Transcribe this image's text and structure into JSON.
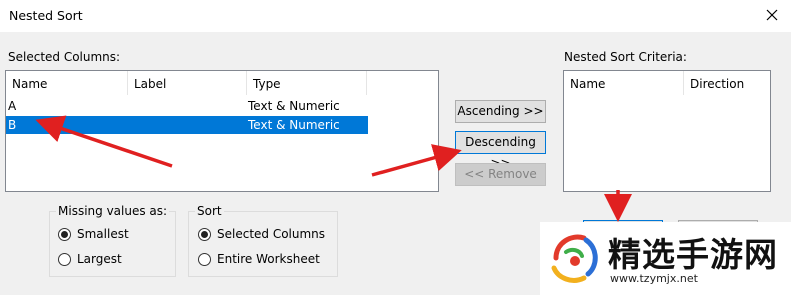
{
  "window": {
    "title": "Nested Sort"
  },
  "selected_columns": {
    "label": "Selected Columns:",
    "headers": [
      "Name",
      "Label",
      "Type"
    ],
    "rows": [
      {
        "name": "A",
        "label": "",
        "type": "Text & Numeric",
        "selected": false
      },
      {
        "name": "B",
        "label": "",
        "type": "Text & Numeric",
        "selected": true
      }
    ]
  },
  "buttons": {
    "ascending": "Ascending >>",
    "descending": "Descending >>",
    "remove": "<< Remove"
  },
  "nested_criteria": {
    "label": "Nested Sort Criteria:",
    "headers": [
      "Name",
      "Direction"
    ]
  },
  "missing_values": {
    "title": "Missing values as:",
    "options": [
      "Smallest",
      "Largest"
    ],
    "selected": "Smallest"
  },
  "sort": {
    "title": "Sort",
    "options": [
      "Selected Columns",
      "Entire Worksheet"
    ],
    "selected": "Selected Columns"
  },
  "watermark": {
    "text": "精选手游网",
    "url": "www.tzymjx.net"
  },
  "colors": {
    "selection": "#0078d7",
    "arrow": "#e02020"
  }
}
